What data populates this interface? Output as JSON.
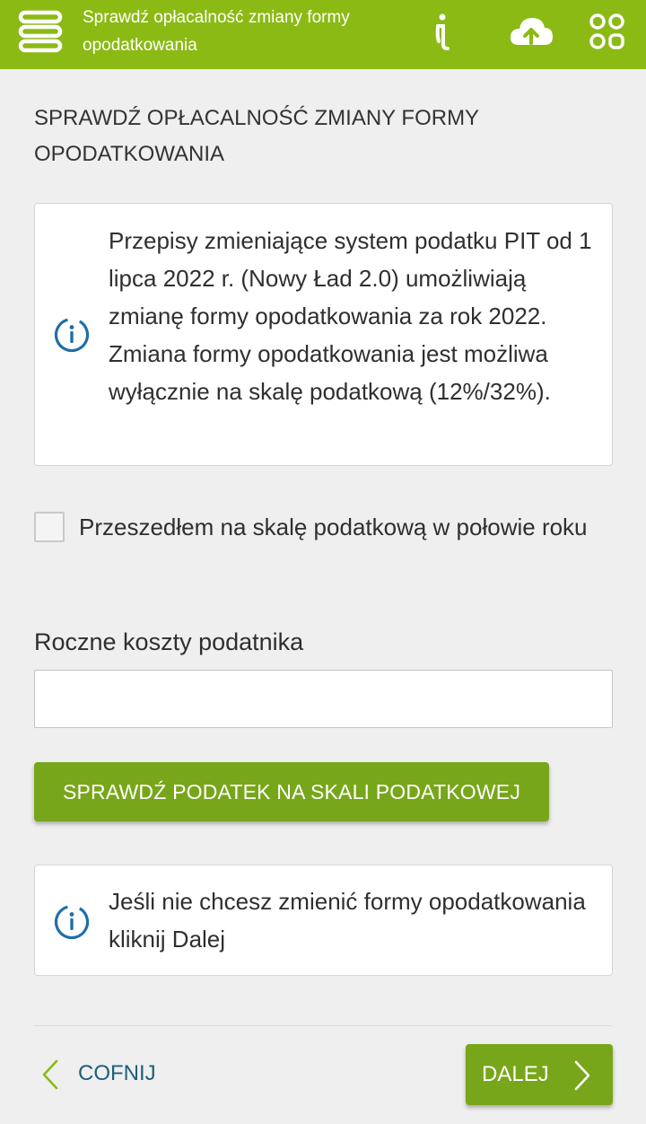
{
  "header": {
    "title": "Sprawdź opłacalność zmiany formy opodatkowania",
    "menu_icon": "layers-menu-icon",
    "info_icon": "info-icon",
    "cloud_icon": "cloud-upload-icon",
    "apps_icon": "apps-grid-icon",
    "background": "#8bba15"
  },
  "main": {
    "heading": "SPRAWDŹ OPŁACALNOŚĆ ZMIANY FORMY OPODATKOWANIA",
    "info_box_1": "Przepisy zmieniające system podatku PIT od 1 lipca 2022 r. (Nowy Ład 2.0) umożliwiają zmianę formy opodatkowania za rok 2022. Zmiana formy opodatkowania jest możliwa wyłącznie na skalę podatkową (12%/32%).",
    "checkbox_label": "Przeszedłem na skalę podatkową w połowie roku",
    "checkbox_checked": false,
    "field_label": "Roczne koszty podatnika",
    "field_value": "",
    "check_button_label": "SPRAWDŹ PODATEK NA SKALI PODATKOWEJ",
    "info_box_2": "Jeśli nie chcesz zmienić formy opodatkowania kliknij Dalej"
  },
  "footer": {
    "back_label": "COFNIJ",
    "next_label": "DALEJ"
  },
  "colors": {
    "accent_green": "#78a61a",
    "info_blue": "#1f6fa8",
    "link_blue": "#1f5d7a"
  }
}
